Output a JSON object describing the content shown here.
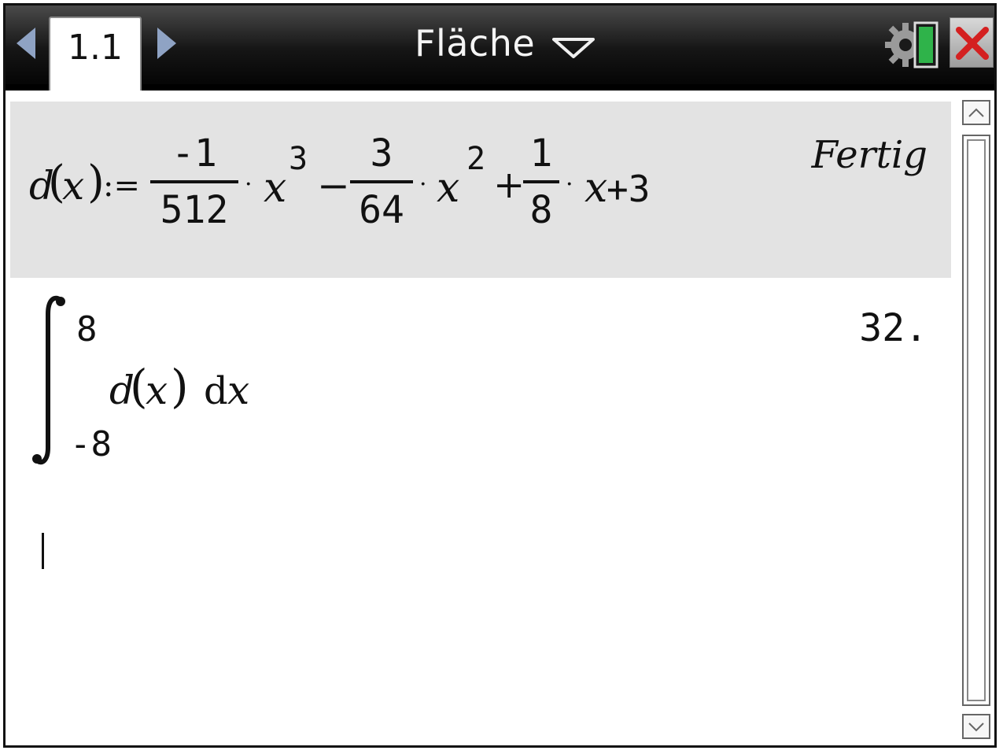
{
  "titlebar": {
    "page_tab": "1.1",
    "document_title": "Fläche"
  },
  "history": [
    {
      "input": {
        "function_name": "d",
        "variable": "x",
        "assign": ":=",
        "term1": {
          "numerator": "-1",
          "denominator": "512",
          "power": "3"
        },
        "term2": {
          "sign": "−",
          "numerator": "3",
          "denominator": "64",
          "power": "2"
        },
        "term3": {
          "sign": "+",
          "numerator": "1",
          "denominator": "8"
        },
        "constant": "+3"
      },
      "output": "Fertig"
    },
    {
      "input": {
        "upper_limit": "8",
        "lower_limit": "-8",
        "integrand_function": "d",
        "integrand_variable": "x",
        "differential": "d",
        "differential_var": "x"
      },
      "output": "32."
    }
  ],
  "colors": {
    "titlebar": "#000000",
    "entry_highlight": "#e3e3e3",
    "nav_arrow": "#8fa3c4",
    "close_red": "#d42020",
    "battery_green": "#2fb34a"
  },
  "icons": {
    "left_nav": "chevron-left-icon",
    "right_nav": "chevron-right-icon",
    "dropdown": "chevron-down-icon",
    "settings_battery": "gear-battery-icon",
    "close": "close-icon",
    "scroll_up": "chevron-up-icon",
    "scroll_down": "chevron-down-icon"
  }
}
